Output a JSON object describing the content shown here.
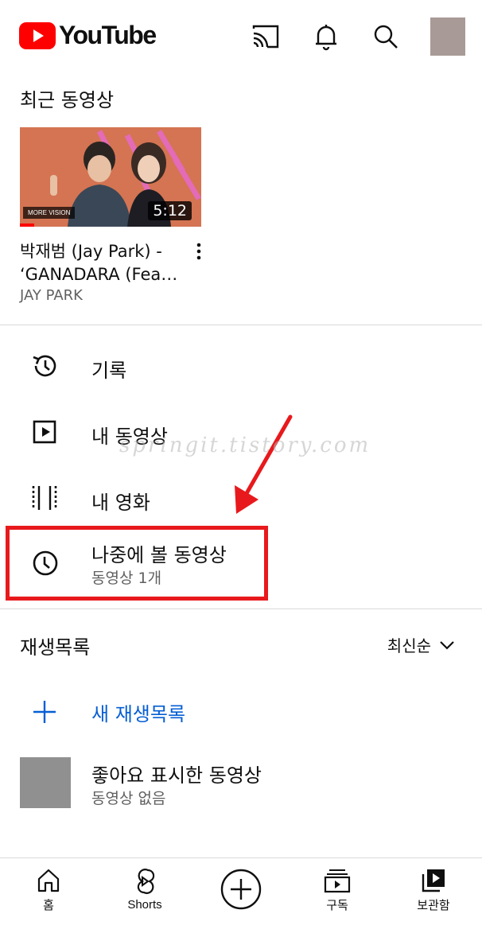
{
  "header": {
    "logo_text": "YouTube",
    "icons": [
      "cast-icon",
      "notifications-icon",
      "search-icon"
    ],
    "brand_color": "#ff0000"
  },
  "recent": {
    "title": "최근 동영상",
    "video": {
      "title_line1": "박재범 (Jay Park) -",
      "title_line2": "‘GANADARA (Fea…",
      "channel": "JAY PARK",
      "duration": "5:12",
      "badge": "MORE VISION"
    }
  },
  "menu": {
    "history": "기록",
    "your_videos": "내 동영상",
    "your_movies": "내 영화",
    "watch_later": "나중에 볼 동영상",
    "watch_later_count": "동영상 1개"
  },
  "watermark": "springit.tistory.com",
  "playlists": {
    "title": "재생목록",
    "sort_label": "최신순",
    "new_playlist": "새 재생목록",
    "liked": {
      "title": "좋아요 표시한 동영상",
      "subtitle": "동영상 없음"
    }
  },
  "bottom_nav": {
    "home": "홈",
    "shorts": "Shorts",
    "subscriptions": "구독",
    "library": "보관함"
  },
  "colors": {
    "accent_link": "#065fd4",
    "highlight": "#e8191c",
    "arrow": "#e8191c"
  }
}
